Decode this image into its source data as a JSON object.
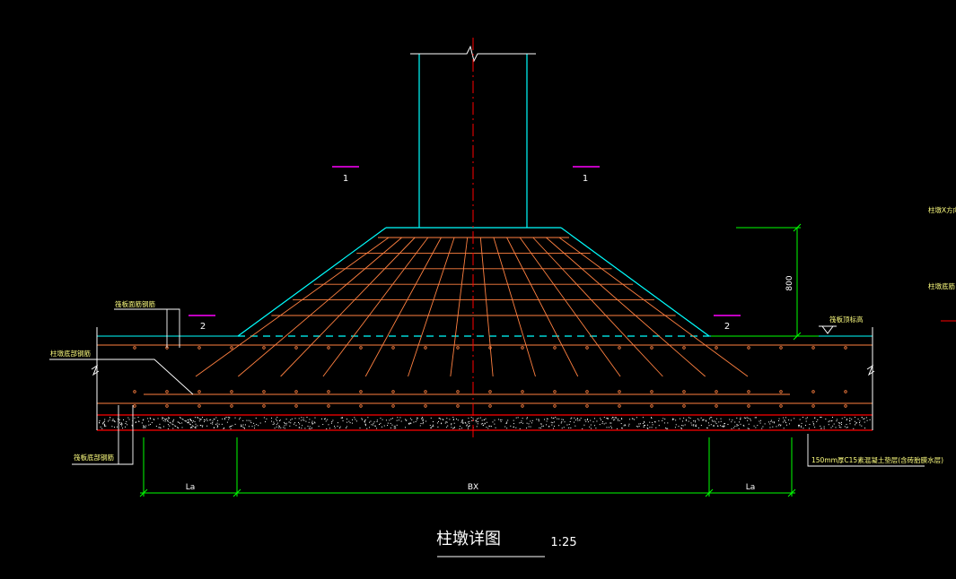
{
  "drawing": {
    "title": "柱墩详图",
    "scale": "1:25",
    "labels": {
      "section_1_left": "1",
      "section_1_right": "1",
      "section_2_left": "2",
      "section_2_right": "2",
      "dim_height": "800",
      "dim_la_left": "La",
      "dim_bx": "BX",
      "dim_la_right": "La",
      "top_rebar_left": "筏板面筋钢筋",
      "pier_bottom_rebar": "柱墩底部钢筋",
      "raft_bottom_rebar": "筏板底部钢筋",
      "raft_top_elevation": "筏板顶标高",
      "pier_x_direction": "柱墩X方向",
      "pier_rebar": "柱墩底筋",
      "cushion_note": "150mm厚C15素混凝土垫层(含砖胎膜水层)"
    }
  },
  "colors": {
    "background": "#000000",
    "column": "#00ffff",
    "rebar": "#ff8040",
    "red": "#ff0000",
    "green": "#00ff00",
    "white": "#ffffff",
    "yellow": "#ffff80",
    "magenta": "#ff00ff"
  }
}
